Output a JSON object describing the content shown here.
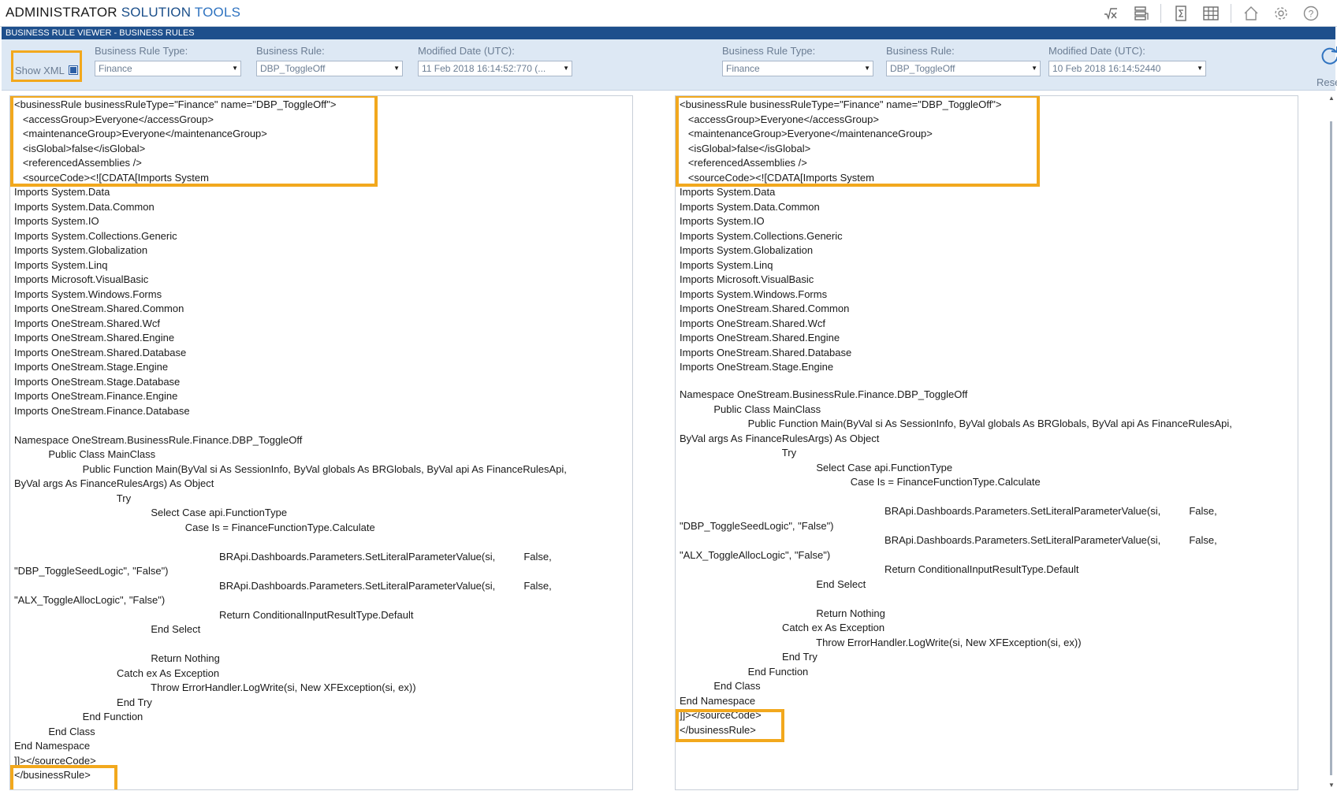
{
  "app": {
    "title_part1": "ADMINISTRATOR",
    "title_part2": "SOLUTION",
    "title_part3": "TOOLS",
    "icons": [
      "formula-icon",
      "server-icon",
      "sigma-doc-icon",
      "grid-icon",
      "home-icon",
      "gear-icon",
      "help-icon"
    ]
  },
  "section": {
    "title": "BUSINESS RULE VIEWER - BUSINESS RULES"
  },
  "toolbar": {
    "show_xml_label": "Show XML",
    "show_xml_checked": true,
    "reset_label": "Reset",
    "left": {
      "type_label": "Business Rule Type:",
      "type_value": "Finance",
      "rule_label": "Business Rule:",
      "rule_value": "DBP_ToggleOff",
      "date_label": "Modified Date (UTC):",
      "date_value": "11 Feb 2018 16:14:52:770 (..."
    },
    "right": {
      "type_label": "Business Rule Type:",
      "type_value": "Finance",
      "rule_label": "Business Rule:",
      "rule_value": "DBP_ToggleOff",
      "date_label": "Modified Date (UTC):",
      "date_value": "10 Feb 2018 16:14:52440"
    }
  },
  "left_code": [
    "<businessRule businessRuleType=\"Finance\" name=\"DBP_ToggleOff\">",
    "   <accessGroup>Everyone</accessGroup>",
    "   <maintenanceGroup>Everyone</maintenanceGroup>",
    "   <isGlobal>false</isGlobal>",
    "   <referencedAssemblies />",
    "   <sourceCode><![CDATA[Imports System",
    "Imports System.Data",
    "Imports System.Data.Common",
    "Imports System.IO",
    "Imports System.Collections.Generic",
    "Imports System.Globalization",
    "Imports System.Linq",
    "Imports Microsoft.VisualBasic",
    "Imports System.Windows.Forms",
    "Imports OneStream.Shared.Common",
    "Imports OneStream.Shared.Wcf",
    "Imports OneStream.Shared.Engine",
    "Imports OneStream.Shared.Database",
    "Imports OneStream.Stage.Engine",
    "Imports OneStream.Stage.Database",
    "Imports OneStream.Finance.Engine",
    "Imports OneStream.Finance.Database",
    "",
    "Namespace OneStream.BusinessRule.Finance.DBP_ToggleOff",
    "            Public Class MainClass",
    "                        Public Function Main(ByVal si As SessionInfo, ByVal globals As BRGlobals, ByVal api As FinanceRulesApi,",
    "ByVal args As FinanceRulesArgs) As Object",
    "                                    Try",
    "                                                Select Case api.FunctionType",
    "                                                            Case Is = FinanceFunctionType.Calculate",
    "",
    "                                                                        BRApi.Dashboards.Parameters.SetLiteralParameterValue(si,          False,",
    "\"DBP_ToggleSeedLogic\", \"False\")",
    "                                                                        BRApi.Dashboards.Parameters.SetLiteralParameterValue(si,          False,",
    "\"ALX_ToggleAllocLogic\", \"False\")",
    "                                                                        Return ConditionalInputResultType.Default",
    "                                                End Select",
    "",
    "                                                Return Nothing",
    "                                    Catch ex As Exception",
    "                                                Throw ErrorHandler.LogWrite(si, New XFException(si, ex))",
    "                                    End Try",
    "                        End Function",
    "            End Class",
    "End Namespace",
    "]]></sourceCode>",
    "</businessRule>"
  ],
  "right_code_a": [
    "<businessRule businessRuleType=\"Finance\" name=\"DBP_ToggleOff\">",
    "   <accessGroup>Everyone</accessGroup>",
    "   <maintenanceGroup>Everyone</maintenanceGroup>",
    "   <isGlobal>false</isGlobal>",
    "   <referencedAssemblies />",
    "   <sourceCode><![CDATA[Imports System",
    "Imports System.Data",
    "Imports System.Data.Common",
    "Imports System.IO",
    "Imports System.Collections.Generic",
    "Imports System.Globalization",
    "Imports System.Linq",
    "Imports Microsoft.VisualBasic",
    "Imports System.Windows.Forms",
    "Imports OneStream.Shared.Common",
    "Imports OneStream.Shared.Wcf",
    "Imports OneStream.Shared.Engine",
    "Imports OneStream.Shared.Database",
    "Imports OneStream.Stage.Engine"
  ],
  "right_code_b": [
    "Namespace OneStream.BusinessRule.Finance.DBP_ToggleOff",
    "            Public Class MainClass",
    "                        Public Function Main(ByVal si As SessionInfo, ByVal globals As BRGlobals, ByVal api As FinanceRulesApi,",
    "ByVal args As FinanceRulesArgs) As Object",
    "                                    Try",
    "                                                Select Case api.FunctionType",
    "                                                            Case Is = FinanceFunctionType.Calculate",
    "",
    "                                                                        BRApi.Dashboards.Parameters.SetLiteralParameterValue(si,          False,",
    "\"DBP_ToggleSeedLogic\", \"False\")",
    "                                                                        BRApi.Dashboards.Parameters.SetLiteralParameterValue(si,          False,",
    "\"ALX_ToggleAllocLogic\", \"False\")",
    "                                                                        Return ConditionalInputResultType.Default",
    "                                                End Select",
    "",
    "                                                Return Nothing",
    "                                    Catch ex As Exception",
    "                                                Throw ErrorHandler.LogWrite(si, New XFException(si, ex))",
    "                                    End Try",
    "                        End Function",
    "            End Class",
    "End Namespace",
    "]]></sourceCode>",
    "</businessRule>"
  ],
  "colors": {
    "accent_blue": "#1e4f8c",
    "toolbar_bg": "#dde8f4",
    "highlight": "#f2a81d"
  }
}
